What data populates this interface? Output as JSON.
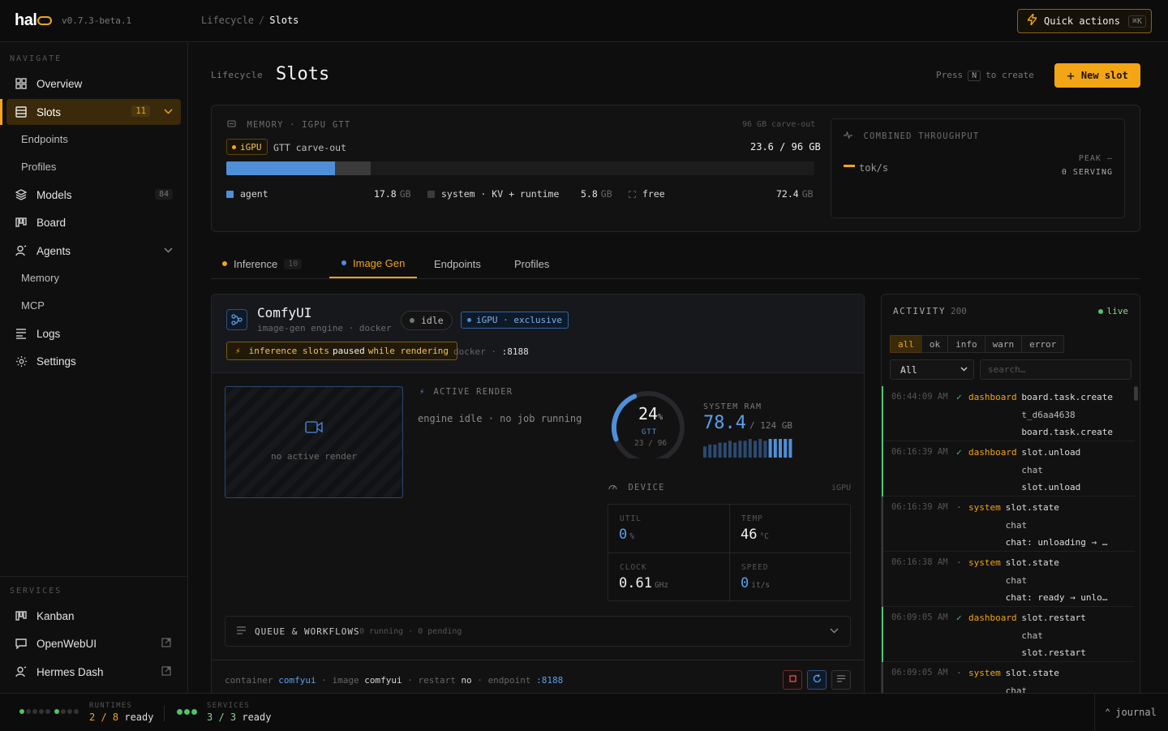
{
  "app": {
    "logo": "hal",
    "version": "v0.7.3-beta.1"
  },
  "topbar": {
    "crumbs": [
      "Lifecycle",
      "Slots"
    ],
    "quick_actions": "Quick actions",
    "quick_kbd": "⌘K"
  },
  "sidebar": {
    "navigate_label": "NAVIGATE",
    "items": [
      {
        "label": "Overview"
      },
      {
        "label": "Slots",
        "badge": "11"
      },
      {
        "label": "Endpoints"
      },
      {
        "label": "Profiles"
      },
      {
        "label": "Models",
        "badge": "84"
      },
      {
        "label": "Board"
      },
      {
        "label": "Agents"
      },
      {
        "label": "Memory"
      },
      {
        "label": "MCP"
      },
      {
        "label": "Logs"
      },
      {
        "label": "Settings"
      }
    ],
    "services_label": "SERVICES",
    "services": [
      {
        "label": "Kanban"
      },
      {
        "label": "OpenWebUI"
      },
      {
        "label": "Hermes Dash"
      }
    ]
  },
  "page": {
    "crumb": "Lifecycle",
    "title": "Slots",
    "press_pre": "Press",
    "press_key": "N",
    "press_post": "to create",
    "new_slot": "New slot"
  },
  "memory": {
    "label": "MEMORY · IGPU GTT",
    "carveout": "96 GB carve-out",
    "pill": "iGPU",
    "gtt_text": "GTT carve-out",
    "used": "23.6",
    "total": "96 GB",
    "agent_fraction": 0.185,
    "system_fraction": 0.06,
    "legend": [
      {
        "label": "agent",
        "value": "17.8",
        "unit": "GB"
      },
      {
        "label": "system · KV + runtime",
        "value": "5.8",
        "unit": "GB"
      },
      {
        "label": "free",
        "value": "72.4",
        "unit": "GB"
      }
    ]
  },
  "throughput": {
    "label": "COMBINED THROUGHPUT",
    "peak": "PEAK —",
    "serving": "0 SERVING",
    "unit": "tok/s"
  },
  "tabs": [
    {
      "label": "Inference",
      "count": "10"
    },
    {
      "label": "Image Gen"
    },
    {
      "label": "Endpoints"
    },
    {
      "label": "Profiles"
    }
  ],
  "comfy": {
    "name": "ComfyUI",
    "sub": "image-gen engine · docker",
    "status": "idle",
    "exclusive": "iGPU · exclusive",
    "warn_pre": "inference slots",
    "warn_mid": "paused",
    "warn_post": "while rendering",
    "docker_label": "docker ·",
    "docker_port": ":8188",
    "preview_text": "no active render",
    "active_render_label": "ACTIVE RENDER",
    "active_render_text": "engine idle · no job running",
    "gauge_pct": "24",
    "gauge_pct_unit": "%",
    "gauge_value": 0.24,
    "gauge_gtt": "GTT",
    "gauge_sub": "23 / 96",
    "sysram_label": "SYSTEM RAM",
    "sysram_val": "78.4",
    "sysram_total": "/ 124 GB",
    "sysram_spark": [
      0.6,
      0.7,
      0.7,
      0.8,
      0.8,
      0.9,
      0.8,
      0.9,
      0.9,
      1.0,
      0.9,
      1.0,
      0.9,
      1.0,
      1.0,
      1.0,
      1.0,
      1.0
    ],
    "device_label": "DEVICE",
    "device_right": "iGPU",
    "device": [
      {
        "label": "UTIL",
        "value": "0",
        "unit": "%"
      },
      {
        "label": "TEMP",
        "value": "46",
        "unit": "°C"
      },
      {
        "label": "CLOCK",
        "value": "0.61",
        "unit": "GHz"
      },
      {
        "label": "SPEED",
        "value": "0",
        "unit": "it/s"
      }
    ],
    "queue_label": "QUEUE & WORKFLOWS",
    "queue_sub": "0 running · 0 pending",
    "foot": {
      "container_label": "container",
      "container": "comfyui",
      "image_label": "image",
      "image": "comfyui",
      "restart_label": "restart",
      "restart": "no",
      "endpoint_label": "endpoint",
      "endpoint": ":8188"
    }
  },
  "activity": {
    "title": "ACTIVITY",
    "count": "200",
    "live": "live",
    "filters": [
      "all",
      "ok",
      "info",
      "warn",
      "error"
    ],
    "select": "All",
    "search_placeholder": "search…",
    "logs": [
      {
        "ts": "06:44:09 AM",
        "status": "✓",
        "src": "dashboard",
        "ev": "board.task.create",
        "l2": "t_d6aa4638",
        "l3": "board.task.create"
      },
      {
        "ts": "06:16:39 AM",
        "status": "✓",
        "src": "dashboard",
        "ev": "slot.unload",
        "l2": "chat",
        "l3": "slot.unload"
      },
      {
        "ts": "06:16:39 AM",
        "status": "·",
        "src": "system",
        "ev": "slot.state",
        "l2": "chat",
        "l3": "chat: unloading → off…"
      },
      {
        "ts": "06:16:38 AM",
        "status": "·",
        "src": "system",
        "ev": "slot.state",
        "l2": "chat",
        "l3": "chat: ready → unloadi…"
      },
      {
        "ts": "06:09:05 AM",
        "status": "✓",
        "src": "dashboard",
        "ev": "slot.restart",
        "l2": "chat",
        "l3": "slot.restart"
      },
      {
        "ts": "06:09:05 AM",
        "status": "·",
        "src": "system",
        "ev": "slot.state",
        "l2": "chat",
        "l3": ""
      }
    ]
  },
  "status": {
    "runtimes_label": "RUNTIMES",
    "runtimes_ready": "2 / 8",
    "runtimes_word": "ready",
    "services_label": "SERVICES",
    "services_ready": "3 / 3",
    "services_word": "ready",
    "journal": "journal"
  },
  "colors": {
    "accent": "#f2a515",
    "blue": "#4f8fd8",
    "green": "#4fc36b"
  }
}
